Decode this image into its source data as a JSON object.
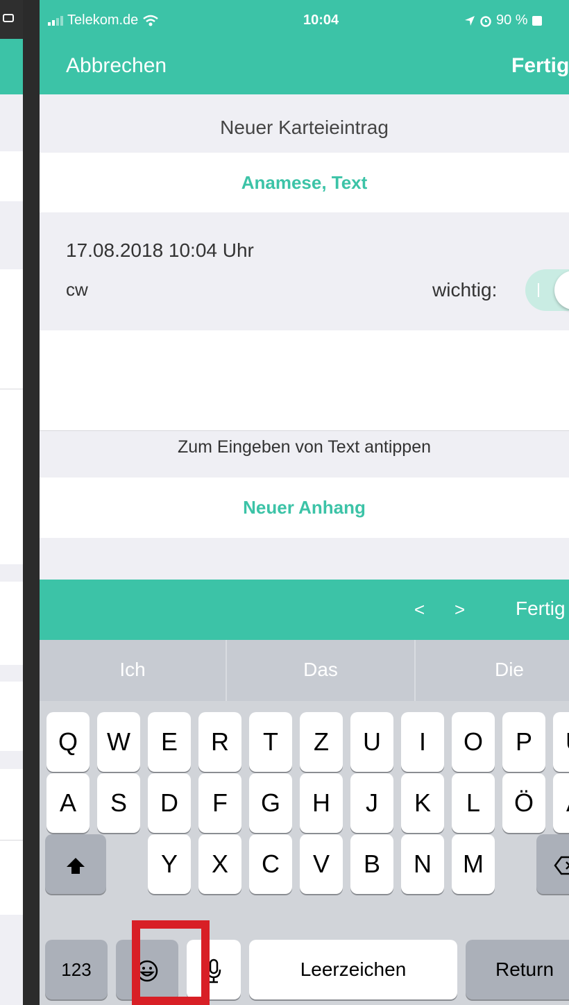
{
  "status_bar": {
    "carrier": "Telekom.de",
    "time": "10:04",
    "battery": "90 %",
    "colors": {
      "bar": "#3cc3a7"
    }
  },
  "nav": {
    "cancel_label": "Abbrechen",
    "done_label": "Fertig"
  },
  "form": {
    "section_title": "Neuer Karteieintrag",
    "entry_type": "Anamese, Text",
    "date": "17.08.2018 10:04 Uhr",
    "user": "cw",
    "important_label": "wichtig:",
    "text_hint": "Zum Eingeben von Text antippen",
    "new_attachment": "Neuer Anhang"
  },
  "accessory": {
    "prev": "<",
    "next": ">",
    "done": "Fertig"
  },
  "keyboard": {
    "suggestions": [
      "Ich",
      "Das",
      "Die"
    ],
    "row1": [
      "Q",
      "W",
      "E",
      "R",
      "T",
      "Z",
      "U",
      "I",
      "O",
      "P",
      "Ü"
    ],
    "row2": [
      "A",
      "S",
      "D",
      "F",
      "G",
      "H",
      "J",
      "K",
      "L",
      "Ö",
      "Ä"
    ],
    "row3": [
      "Y",
      "X",
      "C",
      "V",
      "B",
      "N",
      "M"
    ],
    "numbers_label": "123",
    "space_label": "Leerzeichen",
    "return_label": "Return",
    "icons": {
      "shift": "shift-icon",
      "delete": "delete-icon",
      "emoji": "emoji-icon",
      "mic": "microphone-icon"
    }
  },
  "colors": {
    "accent": "#3cc3a7",
    "highlight": "#d81f26"
  }
}
